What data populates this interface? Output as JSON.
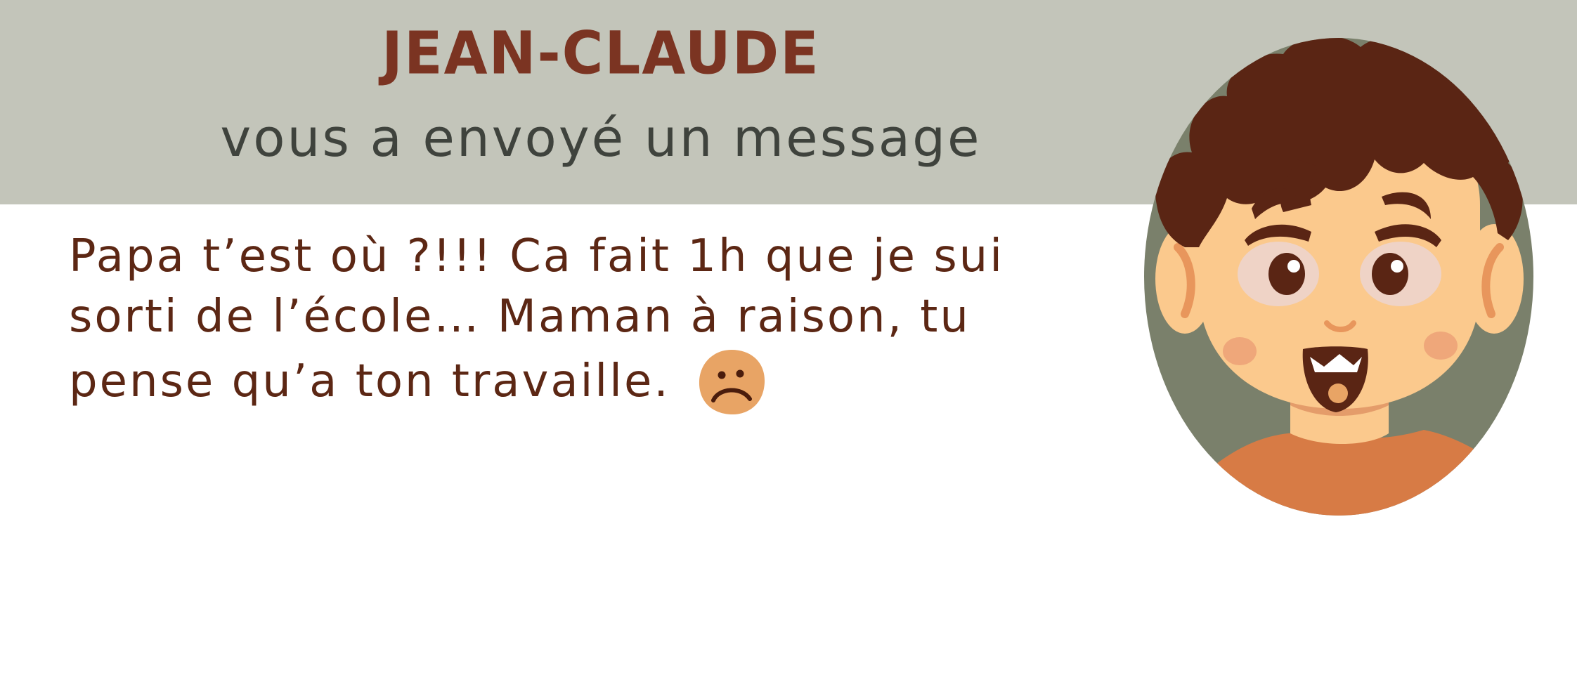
{
  "notification": {
    "sender_name": "JEAN-CLAUDE",
    "subtitle": "vous a envoyé un message",
    "message_text": "Papa t’est où ?!!! Ca fait 1h que je sui sorti de l’école… Maman à raison, tu pense qu’a ton travaille.",
    "emoji": "sad-face-icon",
    "avatar": "child-avatar"
  },
  "colors": {
    "header_band": "#c3c5ba",
    "sender_name": "#7b3422",
    "subtitle": "#3f433d",
    "message_text": "#5c2714",
    "avatar_background": "#7a806b",
    "hair": "#5a2514",
    "skin": "#fbc98d",
    "shirt": "#d77b45",
    "emoji_face": "#e8a465"
  }
}
